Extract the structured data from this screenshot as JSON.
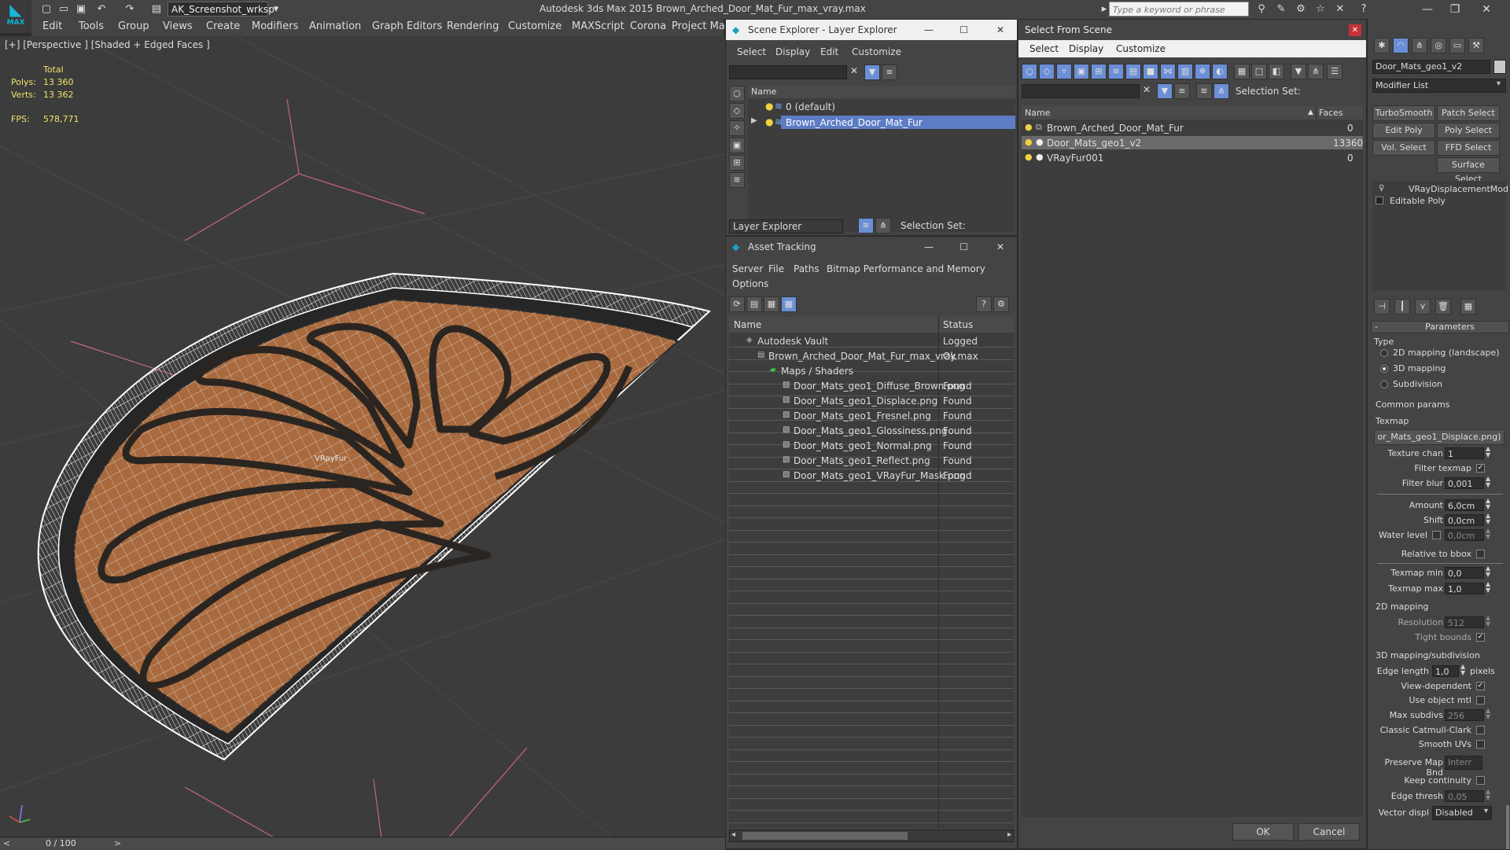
{
  "app": {
    "title": "Autodesk 3ds Max  2015    Brown_Arched_Door_Mat_Fur_max_vray.max",
    "logo": "MAX",
    "workspace": "AK_Screenshot_wrksp",
    "search_placeholder": "Type a keyword or phrase"
  },
  "menu": [
    "Edit",
    "Tools",
    "Group",
    "Views",
    "Create",
    "Modifiers",
    "Animation",
    "Graph Editors",
    "Rendering",
    "Customize",
    "MAXScript",
    "Corona",
    "Project Man"
  ],
  "viewport": {
    "label": "[+] [Perspective ] [Shaded + Edged Faces ]",
    "stats_header": "Total",
    "polys_label": "Polys:",
    "polys_value": "13 360",
    "verts_label": "Verts:",
    "verts_value": "13 362",
    "fps_label": "FPS:",
    "fps_value": "578,771",
    "object_label": "VRayFur"
  },
  "timeline": {
    "value": "0 / 100"
  },
  "scene_explorer": {
    "title": "Scene Explorer - Layer Explorer",
    "menu": [
      "Select",
      "Display",
      "Edit",
      "Customize"
    ],
    "col_name": "Name",
    "rows": [
      "0 (default)",
      "Brown_Arched_Door_Mat_Fur"
    ],
    "footer_label": "Layer Explorer",
    "selection_set": "Selection Set:"
  },
  "asset_tracking": {
    "title": "Asset Tracking",
    "menu": [
      "Server",
      "File",
      "Paths",
      "Bitmap Performance and Memory",
      "Options"
    ],
    "col_name": "Name",
    "col_status": "Status",
    "rows": [
      {
        "name": "Autodesk Vault",
        "status": "Logged"
      },
      {
        "name": "Brown_Arched_Door_Mat_Fur_max_vray.max",
        "status": "Ok"
      },
      {
        "name": "Maps / Shaders",
        "status": ""
      },
      {
        "name": "Door_Mats_geo1_Diffuse_Brown.png",
        "status": "Found"
      },
      {
        "name": "Door_Mats_geo1_Displace.png",
        "status": "Found"
      },
      {
        "name": "Door_Mats_geo1_Fresnel.png",
        "status": "Found"
      },
      {
        "name": "Door_Mats_geo1_Glossiness.png",
        "status": "Found"
      },
      {
        "name": "Door_Mats_geo1_Normal.png",
        "status": "Found"
      },
      {
        "name": "Door_Mats_geo1_Reflect.png",
        "status": "Found"
      },
      {
        "name": "Door_Mats_geo1_VRayFur_Mask.png",
        "status": "Found"
      }
    ]
  },
  "select_from_scene": {
    "title": "Select From Scene",
    "menu": [
      "Select",
      "Display",
      "Customize"
    ],
    "selection_set": "Selection Set:",
    "col_name": "Name",
    "col_faces": "Faces",
    "rows": [
      {
        "name": "Brown_Arched_Door_Mat_Fur",
        "faces": "0"
      },
      {
        "name": "Door_Mats_geo1_v2",
        "faces": "13360"
      },
      {
        "name": "VRayFur001",
        "faces": "0"
      }
    ],
    "ok": "OK",
    "cancel": "Cancel"
  },
  "command_panel": {
    "object_name": "Door_Mats_geo1_v2",
    "modifier_list": "Modifier List",
    "buttons": [
      "TurboSmooth",
      "Patch Select",
      "Edit Poly",
      "Poly Select",
      "Vol. Select",
      "FFD Select",
      "Surface Select"
    ],
    "stack": [
      "VRayDisplacementMod",
      "Editable Poly"
    ],
    "rollout": "Parameters",
    "type_label": "Type",
    "type_options": [
      "2D mapping (landscape)",
      "3D mapping",
      "Subdivision"
    ],
    "type_selected": 1,
    "common_params": "Common params",
    "texmap_label": "Texmap",
    "texmap_value": "or_Mats_geo1_Displace.png)",
    "texture_chan_label": "Texture chan",
    "texture_chan": "1",
    "filter_texmap": "Filter texmap",
    "filter_blur_label": "Filter blur",
    "filter_blur": "0,001",
    "amount_label": "Amount",
    "amount": "6,0cm",
    "shift_label": "Shift",
    "shift": "0,0cm",
    "water_level_label": "Water level",
    "water_level": "0,0cm",
    "relative_bbox": "Relative to bbox",
    "texmap_min_label": "Texmap min",
    "texmap_min": "0,0",
    "texmap_max_label": "Texmap max",
    "texmap_max": "1,0",
    "mapping2d": "2D mapping",
    "resolution_label": "Resolution",
    "resolution": "512",
    "tight_bounds": "Tight bounds",
    "mapping3d": "3D mapping/subdivision",
    "edge_length_label": "Edge length",
    "edge_length": "1,0",
    "pixels": "pixels",
    "view_dependent": "View-dependent",
    "use_object_mtl": "Use object mtl",
    "max_subdivs_label": "Max subdivs",
    "max_subdivs": "256",
    "classic_catmull": "Classic Catmull-Clark",
    "smooth_uvs": "Smooth UVs",
    "preserve_map_bnd_label": "Preserve Map Bnd",
    "preserve_map_bnd": "Interr",
    "keep_continuity": "Keep continuity",
    "edge_thresh_label": "Edge thresh",
    "edge_thresh": "0,05",
    "vector_displ_label": "Vector displ",
    "vector_displ": "Disabled"
  }
}
